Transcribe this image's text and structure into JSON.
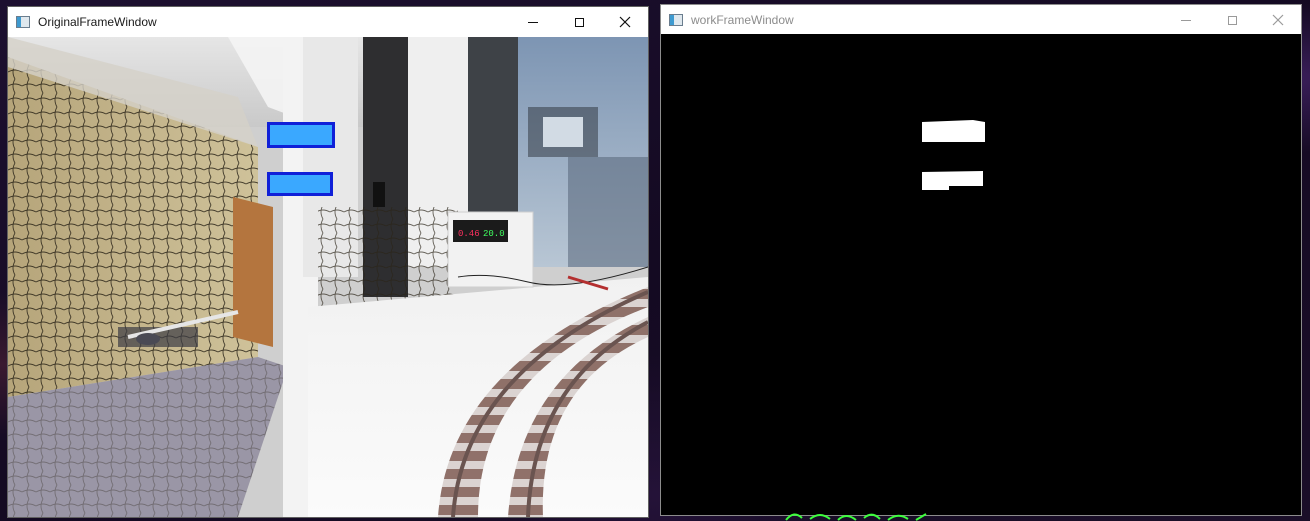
{
  "windows": {
    "original": {
      "title": "OriginalFrameWindow",
      "icon": "opencv-window-icon",
      "controls": {
        "minimize": "minimize-icon",
        "maximize": "maximize-icon",
        "close": "close-icon"
      }
    },
    "work": {
      "title": "workFrameWindow",
      "icon": "opencv-window-icon",
      "controls": {
        "minimize": "minimize-icon",
        "maximize": "maximize-icon",
        "close": "close-icon"
      }
    }
  },
  "camera_scene": {
    "meter_left_reading": "0.46",
    "meter_right_reading": "20.0",
    "detection_box_color": "#3aa8ff",
    "detection_border_color": "#1020d8"
  },
  "colors": {
    "desktop": "#1d1030",
    "mask_background": "#000000",
    "mask_foreground": "#ffffff",
    "taskbar_glow": "#3cff3c"
  }
}
